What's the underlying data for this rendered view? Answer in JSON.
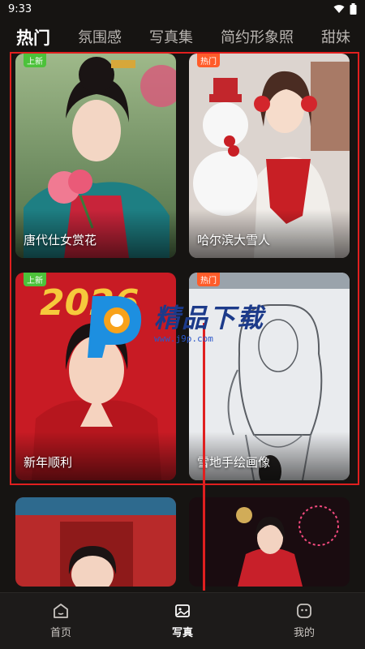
{
  "status": {
    "time": "9:33"
  },
  "tabs": [
    "热门",
    "氛围感",
    "写真集",
    "简约形象照",
    "甜妹"
  ],
  "cards": [
    {
      "title": "唐代仕女赏花",
      "badge": "上新"
    },
    {
      "title": "哈尔滨大雪人",
      "badge": "热门"
    },
    {
      "title": "新年顺利",
      "badge": "上新"
    },
    {
      "title": "雪地手绘画像",
      "badge": "热门"
    },
    {
      "title": ""
    },
    {
      "title": ""
    }
  ],
  "decor": {
    "year_text": "2026"
  },
  "watermark": {
    "brand": "精品下载",
    "url": "www.j9p.com"
  },
  "nav": [
    {
      "label": "首页",
      "icon": "home-icon"
    },
    {
      "label": "写真",
      "icon": "photo-icon"
    },
    {
      "label": "我的",
      "icon": "profile-icon"
    }
  ],
  "colors": {
    "accent": "#e01f1f",
    "badge_new": "#4cc23a",
    "badge_hot": "#ff5c2a",
    "background": "#161412"
  }
}
